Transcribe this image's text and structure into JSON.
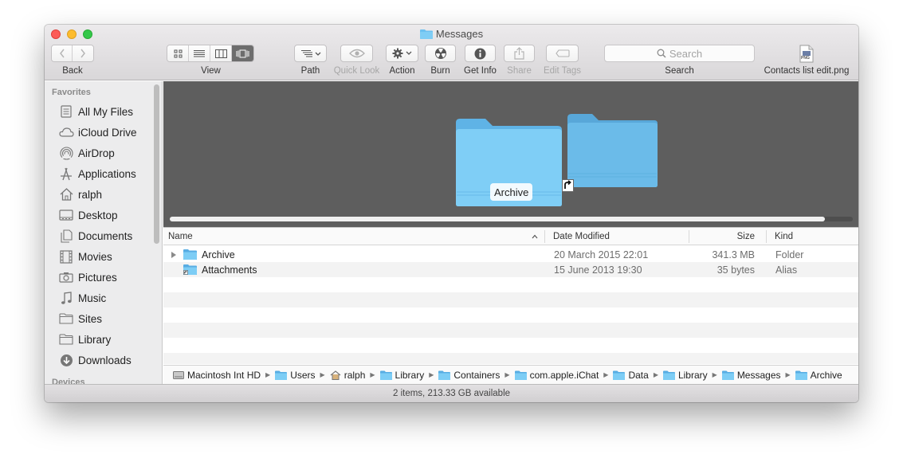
{
  "window": {
    "title": "Messages"
  },
  "toolbar": {
    "back_label": "Back",
    "view_label": "View",
    "path_label": "Path",
    "quicklook_label": "Quick Look",
    "action_label": "Action",
    "burn_label": "Burn",
    "getinfo_label": "Get Info",
    "share_label": "Share",
    "edittags_label": "Edit Tags",
    "search_label": "Search",
    "search_placeholder": "Search",
    "file_label": "Contacts list edit.png",
    "file_badge": "PNG"
  },
  "sidebar": {
    "heading": "Favorites",
    "items": [
      {
        "label": "All My Files",
        "icon": "all-files-icon"
      },
      {
        "label": "iCloud Drive",
        "icon": "cloud-icon"
      },
      {
        "label": "AirDrop",
        "icon": "airdrop-icon"
      },
      {
        "label": "Applications",
        "icon": "applications-icon"
      },
      {
        "label": "ralph",
        "icon": "home-icon"
      },
      {
        "label": "Desktop",
        "icon": "desktop-icon"
      },
      {
        "label": "Documents",
        "icon": "documents-icon"
      },
      {
        "label": "Movies",
        "icon": "movies-icon"
      },
      {
        "label": "Pictures",
        "icon": "camera-icon"
      },
      {
        "label": "Music",
        "icon": "music-icon"
      },
      {
        "label": "Sites",
        "icon": "folder-icon"
      },
      {
        "label": "Library",
        "icon": "folder-icon"
      },
      {
        "label": "Downloads",
        "icon": "downloads-icon"
      }
    ],
    "devices_heading": "Devices"
  },
  "coverflow": {
    "selected_label": "Archive"
  },
  "list": {
    "columns": {
      "name": "Name",
      "date": "Date Modified",
      "size": "Size",
      "kind": "Kind"
    },
    "rows": [
      {
        "name": "Archive",
        "date": "20 March 2015 22:01",
        "size": "341.3 MB",
        "kind": "Folder"
      },
      {
        "name": "Attachments",
        "date": "15 June 2013 19:30",
        "size": "35 bytes",
        "kind": "Alias"
      }
    ]
  },
  "pathbar": {
    "crumbs": [
      "Macintosh Int HD",
      "Users",
      "ralph",
      "Library",
      "Containers",
      "com.apple.iChat",
      "Data",
      "Library",
      "Messages",
      "Archive"
    ]
  },
  "status": {
    "text": "2 items, 213.33 GB available"
  },
  "colors": {
    "folder_blue": "#6cc0f0",
    "close": "#fc5b57",
    "minimize": "#fdbc2e",
    "maximize": "#34c84a"
  }
}
